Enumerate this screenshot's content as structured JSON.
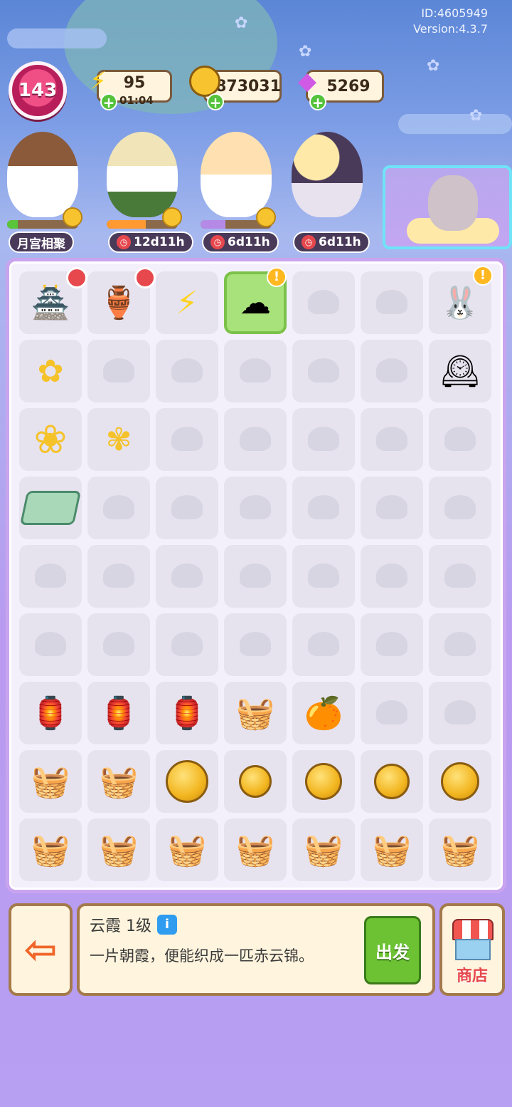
{
  "meta": {
    "id": "ID:4605949",
    "version": "Version:4.3.7"
  },
  "player": {
    "level": "143"
  },
  "resources": {
    "energy": {
      "value": "95",
      "timer": "01:04",
      "icon": "lightning-icon"
    },
    "coins": {
      "value": "873031",
      "icon": "coin-icon"
    },
    "gems": {
      "value": "5269",
      "icon": "gem-icon"
    }
  },
  "events": [
    {
      "label": "月宫相聚",
      "progress": 0.15
    },
    {
      "label": "12d11h",
      "progress": 0.55
    },
    {
      "label": "6d11h",
      "progress": 0.35
    },
    {
      "label": "6d11h",
      "progress": 0
    }
  ],
  "info_panel": {
    "title": "云霞 1级",
    "description": "一片朝霞，便能织成一匹赤云锦。",
    "go_button": "出发"
  },
  "shop": {
    "label": "商店"
  },
  "colors": {
    "accent": "#6cc232",
    "board_border": "#c9a4ee",
    "panel_bg": "#fff4dd"
  }
}
